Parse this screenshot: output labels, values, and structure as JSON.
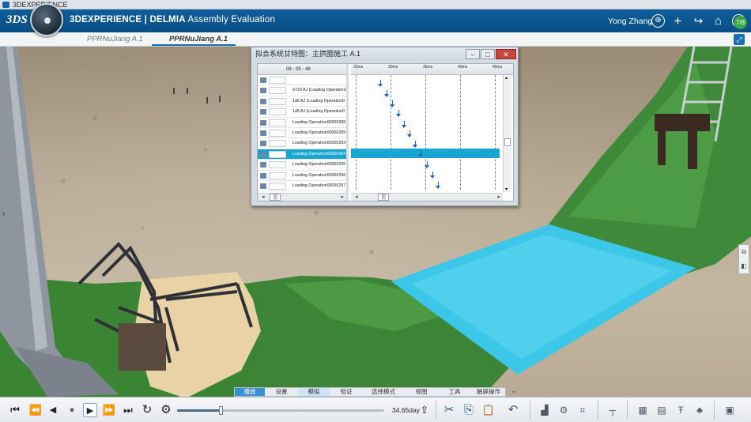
{
  "os_bar": {
    "title": "3DEXPERIENCE"
  },
  "header": {
    "logo": "3DS",
    "app_brand": "3DEXPERIENCE | DELMIA",
    "app_name": "Assembly Evaluation",
    "user": "Yong Zhang",
    "badge": "7/8"
  },
  "tabs": [
    {
      "label": "PPRNuJiang A.1",
      "active": false
    },
    {
      "label": "PPRNuJiang A.1",
      "active": true
    }
  ],
  "gantt_window": {
    "title": "拟合系统甘特图：主拱圈施工 A.1",
    "buttons": {
      "minimize": "–",
      "maximize": "□",
      "close": "✕"
    },
    "list_header": "08 - 09 - 48",
    "rows": [
      {
        "label": "",
        "selected": false
      },
      {
        "label": "6720 AJ (Loading Operation0",
        "selected": false
      },
      {
        "label": "1d9 AJ (Loading Operation0",
        "selected": false
      },
      {
        "label": "1d9 AJ (Loading Operation0",
        "selected": false
      },
      {
        "label": "Loading Operation00000288 AJ",
        "selected": false
      },
      {
        "label": "Loading Operation00000289 AJ",
        "selected": false
      },
      {
        "label": "Loading Operation00000293 AJ",
        "selected": false
      },
      {
        "label": "Loading Operation00000294 AJ",
        "selected": true
      },
      {
        "label": "Loading Operation00000295 AJ",
        "selected": false
      },
      {
        "label": "Loading Operation00000296 AJ",
        "selected": false
      },
      {
        "label": "Loading Operation00000297 AJ",
        "selected": false
      }
    ],
    "time_ticks": [
      "25ms",
      "30ms",
      "35ms",
      "40ms",
      "45ms"
    ],
    "scroll_thumb_glyph": "|||"
  },
  "action_tabs": [
    {
      "label": "播放",
      "state": "active"
    },
    {
      "label": "设置",
      "state": ""
    },
    {
      "label": "模拟",
      "state": "hl"
    },
    {
      "label": "验证",
      "state": ""
    },
    {
      "label": "选择模式",
      "state": ""
    },
    {
      "label": "视图",
      "state": ""
    },
    {
      "label": "工具",
      "state": ""
    },
    {
      "label": "触屏操作",
      "state": ""
    }
  ],
  "playback": {
    "time": "34.65day",
    "progress": 0.21
  },
  "icons": {
    "first": "⏮",
    "prev_step": "⏪",
    "back": "◀",
    "pause": "⏸",
    "play": "▶",
    "next_step": "⏩",
    "last": "⏭",
    "loop": "↻",
    "settings": "⚙",
    "export": "⇪",
    "cut": "✂",
    "copy": "⎘",
    "paste": "📋",
    "undo": "↶",
    "user": "⊕",
    "plus": "+",
    "share": "↪",
    "home": "⌂",
    "help": "?"
  }
}
